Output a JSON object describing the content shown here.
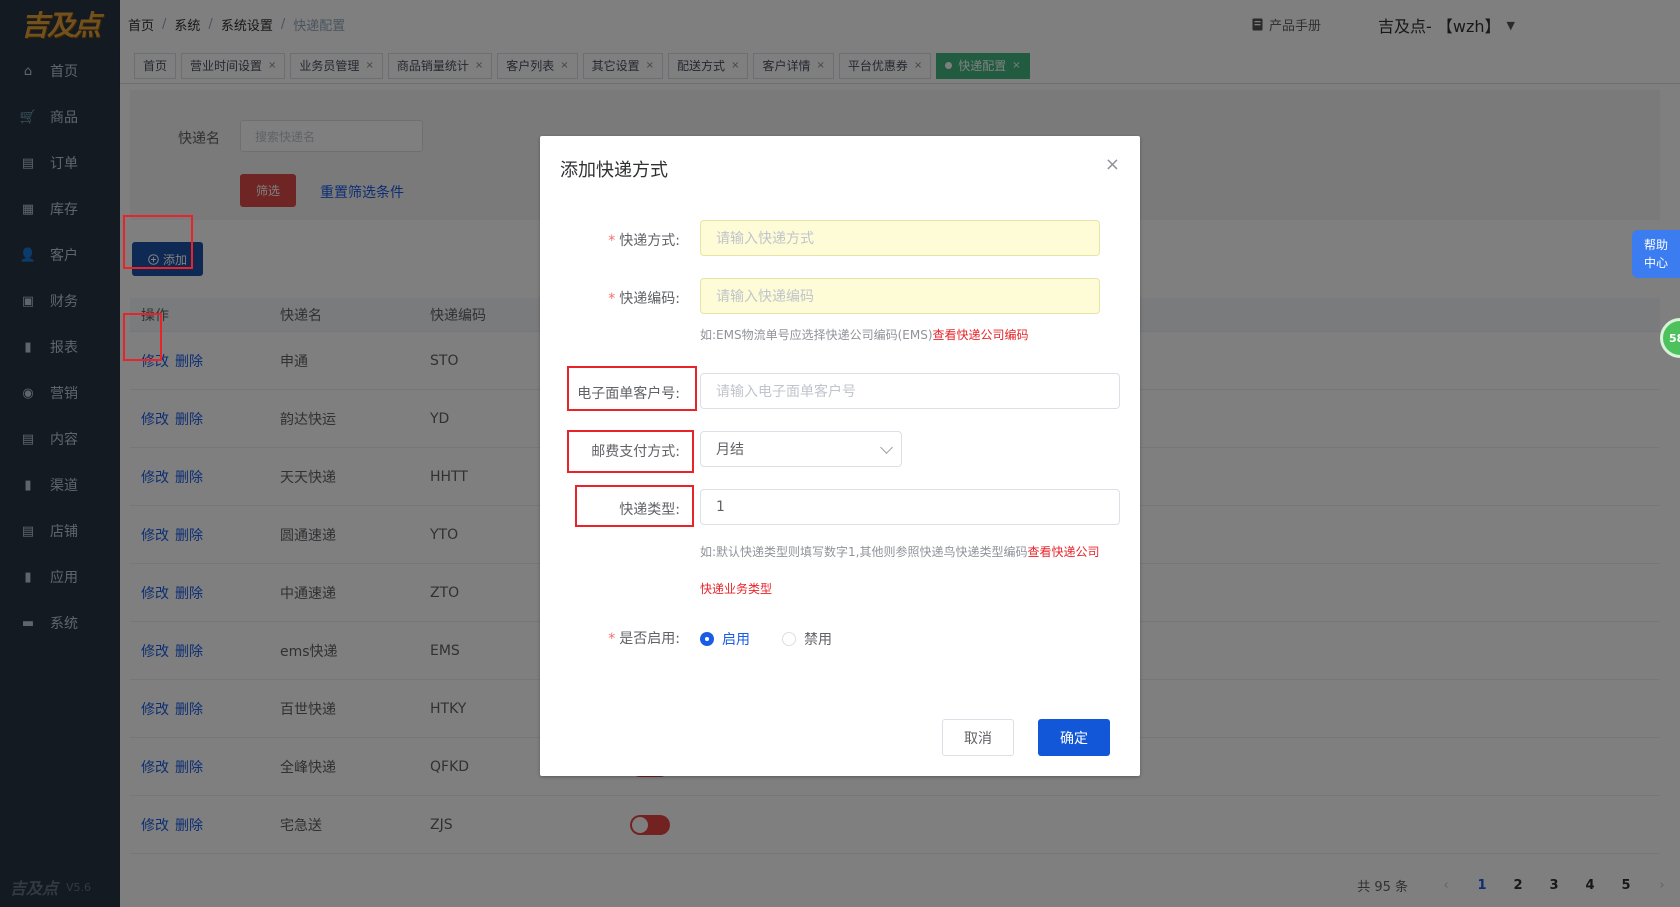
{
  "logo": {
    "text": "吉及点"
  },
  "sidebar": {
    "items": [
      {
        "label": "首页",
        "icon": "home-icon"
      },
      {
        "label": "商品",
        "icon": "cart-icon"
      },
      {
        "label": "订单",
        "icon": "order-icon"
      },
      {
        "label": "库存",
        "icon": "grid-icon"
      },
      {
        "label": "客户",
        "icon": "user-icon"
      },
      {
        "label": "财务",
        "icon": "finance-icon"
      },
      {
        "label": "报表",
        "icon": "bar-chart-icon"
      },
      {
        "label": "营销",
        "icon": "marketing-icon"
      },
      {
        "label": "内容",
        "icon": "content-icon"
      },
      {
        "label": "渠道",
        "icon": "bar-chart-icon"
      },
      {
        "label": "店铺",
        "icon": "store-icon"
      },
      {
        "label": "应用",
        "icon": "bar-chart-icon"
      },
      {
        "label": "系统",
        "icon": "monitor-icon"
      }
    ],
    "footer_logo": "吉及点",
    "version": "V5.6"
  },
  "topbar": {
    "breadcrumb": [
      "首页",
      "系统",
      "系统设置",
      "快递配置"
    ],
    "manual_label": "产品手册",
    "user_label": "吉及点- 【wzh】"
  },
  "tags": [
    {
      "label": "首页",
      "closable": false,
      "active": false
    },
    {
      "label": "营业时间设置",
      "closable": true,
      "active": false
    },
    {
      "label": "业务员管理",
      "closable": true,
      "active": false
    },
    {
      "label": "商品销量统计",
      "closable": true,
      "active": false
    },
    {
      "label": "客户列表",
      "closable": true,
      "active": false
    },
    {
      "label": "其它设置",
      "closable": true,
      "active": false
    },
    {
      "label": "配送方式",
      "closable": true,
      "active": false
    },
    {
      "label": "客户详情",
      "closable": true,
      "active": false
    },
    {
      "label": "平台优惠券",
      "closable": true,
      "active": false
    },
    {
      "label": "快递配置",
      "closable": true,
      "active": true
    }
  ],
  "filter": {
    "label": "快递名",
    "placeholder": "搜索快递名",
    "filter_button": "筛选",
    "reset_link": "重置筛选条件"
  },
  "add_button": "添加",
  "table": {
    "headers": [
      "操作",
      "快递名",
      "快递编码"
    ],
    "edit_label": "修改",
    "delete_label": "删除",
    "rows": [
      {
        "name": "申通",
        "code": "STO"
      },
      {
        "name": "韵达快运",
        "code": "YD"
      },
      {
        "name": "天天快递",
        "code": "HHTT"
      },
      {
        "name": "圆通速递",
        "code": "YTO"
      },
      {
        "name": "中通速递",
        "code": "ZTO"
      },
      {
        "name": "ems快递",
        "code": "EMS"
      },
      {
        "name": "百世快递",
        "code": "HTKY"
      },
      {
        "name": "全峰快递",
        "code": "QFKD"
      },
      {
        "name": "宅急送",
        "code": "ZJS"
      }
    ]
  },
  "pagination": {
    "total": "共 95 条",
    "prev": "‹",
    "next": "›",
    "pages": [
      "1",
      "2",
      "3",
      "4",
      "5"
    ],
    "current": "1"
  },
  "modal": {
    "title": "添加快递方式",
    "close": "×",
    "fields": {
      "method_label": "快递方式:",
      "method_placeholder": "请输入快递方式",
      "code_label": "快递编码:",
      "code_placeholder": "请输入快递编码",
      "code_hint": "如:EMS物流单号应选择快递公司编码(EMS)",
      "code_hint_link": "查看快递公司编码",
      "account_label": "电子面单客户号:",
      "account_placeholder": "请输入电子面单客户号",
      "payment_label": "邮费支付方式:",
      "payment_value": "月结",
      "type_label": "快递类型:",
      "type_value": "1",
      "type_hint": "如:默认快递类型则填写数字1,其他则参照快递鸟快递类型编码",
      "type_hint_link_1": "查看快递公司",
      "type_hint_link_2": "快递业务类型",
      "enabled_label": "是否启用:",
      "enabled_on": "启用",
      "enabled_off": "禁用"
    },
    "cancel": "取消",
    "confirm": "确定"
  },
  "help": {
    "line1": "帮助",
    "line2": "中心"
  },
  "badge": "58",
  "colors": {
    "primary": "#1257d8",
    "danger": "#e8242a",
    "sidebar": "#263445",
    "tag_active": "#42b983"
  }
}
